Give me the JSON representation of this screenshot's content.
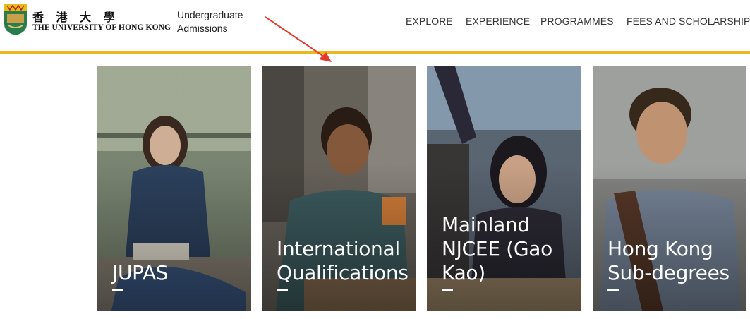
{
  "header": {
    "university_cn": "香 港 大 學",
    "university_en": "THE UNIVERSITY OF HONG KONG",
    "admissions_line1": "Undergraduate",
    "admissions_line2": "Admissions",
    "nav": [
      "EXPLORE",
      "EXPERIENCE",
      "PROGRAMMES",
      "FEES AND SCHOLARSHIPS"
    ]
  },
  "cards": [
    {
      "label": "JUPAS",
      "bg": "#6f7d6a"
    },
    {
      "label": "International Qualifications",
      "bg": "#5e5a55"
    },
    {
      "label": "Mainland NJCEE (Gao Kao)",
      "bg": "#56606b"
    },
    {
      "label": "Hong Kong Sub-degrees",
      "bg": "#7a7a78"
    }
  ],
  "colors": {
    "accent": "#e8b918",
    "annotation_arrow": "#e53a2b"
  }
}
